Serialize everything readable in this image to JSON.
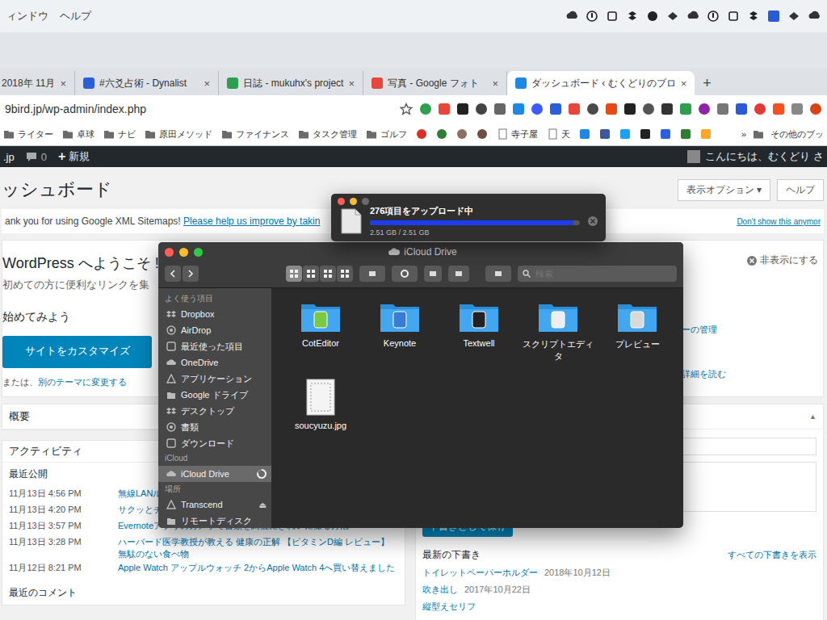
{
  "menubar": {
    "items": [
      "ィンドウ",
      "ヘルプ"
    ]
  },
  "browser": {
    "tabs": [
      {
        "label": "2018年 11月",
        "selected": false
      },
      {
        "label": "#六爻占術 - Dynalist",
        "selected": false
      },
      {
        "label": "日誌 - mukuhx's project",
        "selected": false
      },
      {
        "label": "写真 - Google フォト",
        "selected": false
      },
      {
        "label": "ダッシュボード ‹ むくどりのブロ",
        "selected": true
      }
    ],
    "tab_close": "×",
    "new_tab": "+",
    "url": "9bird.jp/wp-admin/index.php",
    "bookmarks": [
      {
        "label": "ライター",
        "kind": "folder"
      },
      {
        "label": "卓球",
        "kind": "folder"
      },
      {
        "label": "ナビ",
        "kind": "folder"
      },
      {
        "label": "原田メソッド",
        "kind": "folder"
      },
      {
        "label": "ファイナンス",
        "kind": "folder"
      },
      {
        "label": "タスク管理",
        "kind": "folder"
      },
      {
        "label": "ゴルフ",
        "kind": "folder"
      },
      {
        "label": "寺子屋",
        "kind": "link"
      },
      {
        "label": "天",
        "kind": "link"
      }
    ],
    "more": "»",
    "other": "その他のブッ"
  },
  "admin_bar": {
    "site": ".jp",
    "comments": "0",
    "new_icon": "+",
    "new": "新規",
    "greeting": "こんにちは、むくどり さ"
  },
  "dashboard": {
    "title": "ッシュボード",
    "screen_options": "表示オプション ▾",
    "help": "ヘルプ",
    "notice": {
      "text": "ank you for using Google XML Sitemaps! ",
      "link": "Please help us improve by takin",
      "dismiss": "Don't show this anymor"
    },
    "welcome": {
      "title": "WordPress へようこそ !",
      "subtitle": "初めての方に便利なリンクを集",
      "start": "始めてみよう",
      "customize": "サイトをカスタマイズ",
      "or": "または、",
      "other_theme": "別のテーマに変更する",
      "hide": "非表示にする",
      "menu_manage": "ューの管理",
      "read_more": "て詳細を読む"
    },
    "glance": {
      "title": "概要"
    },
    "activity": {
      "title": "アクティビティ",
      "recent": "最近公開",
      "rows": [
        {
          "date": "11月13日 4:56 PM",
          "title": "無線LANルー"
        },
        {
          "date": "11月13日 4:20 PM",
          "title": "サクッとチキンナゲット マクドナルド新商品メニュー食べてみた"
        },
        {
          "date": "11月13日 3:57 PM",
          "title": "Evernoteアプリのカメラで書類を綺麗にきれいに撮る方法"
        },
        {
          "date": "11月13日 3:28 PM",
          "title": "ハーバード医学教授が教える 健康の正解 【ビタミンD編 レビュー】無駄のない食べ物"
        },
        {
          "date": "11月12日 8:21 PM",
          "title": "Apple Watch アップルウォッチ 2からApple Watch 4へ買い替えました"
        }
      ],
      "comments": "最近のコメント"
    },
    "drafts": {
      "toggle": "▲",
      "save": "下書きとして保存",
      "title": "最新の下書き",
      "view_all": "すべての下書きを表示",
      "items": [
        {
          "title": "トイレットペーパーホルダー",
          "date": "2018年10月12日"
        },
        {
          "title": "吹き出し",
          "date": "2017年10月22日"
        },
        {
          "title": "縦型えセリフ"
        }
      ]
    }
  },
  "upload": {
    "title": "276項目をアップロード中",
    "progress": "2.51 GB / 2.51 GB",
    "level": 0.97
  },
  "finder": {
    "title": "iCloud Drive",
    "search_placeholder": "検索",
    "sidebar": [
      {
        "heading": "よく使う項目",
        "items": [
          {
            "label": "Dropbox",
            "selected": false,
            "syncing": false
          },
          {
            "label": "AirDrop",
            "selected": false,
            "syncing": false
          },
          {
            "label": "最近使った項目",
            "selected": false,
            "syncing": false
          },
          {
            "label": "OneDrive",
            "selected": false,
            "syncing": false
          },
          {
            "label": "アプリケーション",
            "selected": false,
            "syncing": false
          },
          {
            "label": "Google ドライブ",
            "selected": false,
            "syncing": false
          },
          {
            "label": "デスクトップ",
            "selected": false,
            "syncing": false
          },
          {
            "label": "書類",
            "selected": false,
            "syncing": false
          },
          {
            "label": "ダウンロード",
            "selected": false,
            "syncing": false
          }
        ]
      },
      {
        "heading": "iCloud",
        "items": [
          {
            "label": "iCloud Drive",
            "selected": true,
            "syncing": true
          }
        ]
      },
      {
        "heading": "場所",
        "items": [
          {
            "label": "Transcend",
            "selected": false,
            "syncing": false,
            "eject": "⏏"
          },
          {
            "label": "リモートディスク",
            "selected": false,
            "syncing": false
          }
        ]
      }
    ],
    "files": [
      {
        "name": "CotEditor",
        "kind": "folder"
      },
      {
        "name": "Keynote",
        "kind": "folder"
      },
      {
        "name": "Textwell",
        "kind": "folder"
      },
      {
        "name": "スクリプトエディタ",
        "kind": "folder"
      },
      {
        "name": "プレビュー",
        "kind": "folder"
      },
      {
        "name": "soucyuzu.jpg",
        "kind": "image"
      }
    ]
  }
}
